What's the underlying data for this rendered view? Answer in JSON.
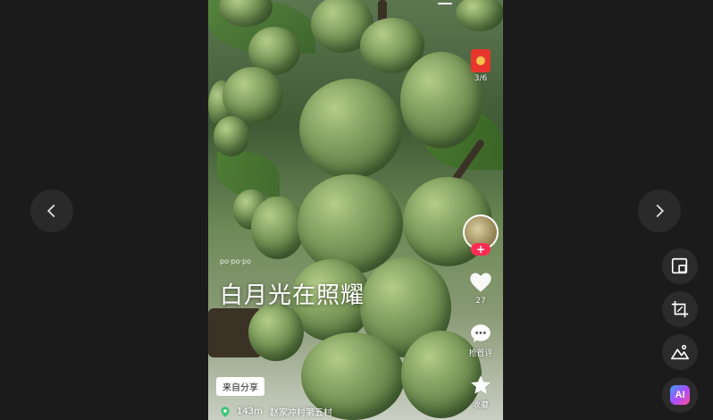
{
  "video": {
    "caption": "白月光在照耀",
    "tiny_tag": "po·po·po",
    "share_chip": "来自分享",
    "location": {
      "distance": "143m",
      "place": "赵家冲村第五村"
    }
  },
  "side": {
    "redpacket_count": "3/6",
    "like_count": "27",
    "comment_label": "抢首评",
    "favorite_label": "收藏",
    "follow_symbol": "+"
  },
  "tools": {
    "ai_label": "AI"
  },
  "colors": {
    "follow_accent": "#fe2c55",
    "redpacket": "#e8352d"
  }
}
